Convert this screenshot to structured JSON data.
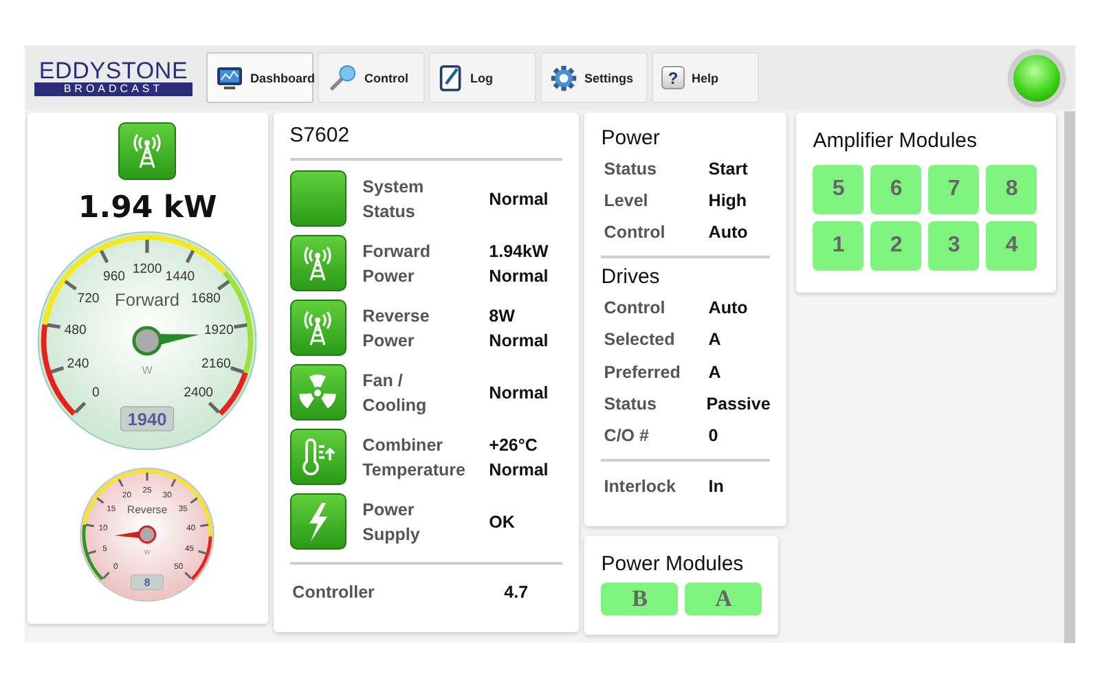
{
  "header": {
    "logo": {
      "name": "EDDYSTONE",
      "tagline": "BROADCAST"
    },
    "nav": [
      {
        "label": "Dashboard",
        "selected": true
      },
      {
        "label": "Control",
        "selected": false
      },
      {
        "label": "Log",
        "selected": false
      },
      {
        "label": "Settings",
        "selected": false
      },
      {
        "label": "Help",
        "glyph": "?",
        "selected": false
      }
    ],
    "status_light": {
      "on": true
    }
  },
  "meters": {
    "headline": "1.94 kW",
    "gauges": [
      {
        "title": "Forward",
        "unit": "W",
        "reading": "1940",
        "ticks": [
          "0",
          "240",
          "480",
          "720",
          "960",
          "1200",
          "1440",
          "1680",
          "1920",
          "2160",
          "2400"
        ]
      },
      {
        "title": "Reverse",
        "unit": "W",
        "reading": "8",
        "ticks": [
          "0",
          "5",
          "10",
          "15",
          "20",
          "25",
          "30",
          "35",
          "40",
          "45",
          "50"
        ]
      }
    ]
  },
  "system": {
    "title": "S7602",
    "rows": [
      {
        "label": "System Status",
        "values": [
          "Normal"
        ]
      },
      {
        "label": "Forward Power",
        "values": [
          "1.94kW",
          "Normal"
        ]
      },
      {
        "label": "Reverse Power",
        "values": [
          "8W",
          "Normal"
        ]
      },
      {
        "label": "Fan / Cooling",
        "values": [
          "Normal"
        ]
      },
      {
        "label": "Combiner Temperature",
        "values": [
          "+26°C",
          "Normal"
        ]
      },
      {
        "label": "Power Supply",
        "values": [
          "OK"
        ]
      }
    ],
    "footer": {
      "label": "Controller",
      "value": "4.7"
    }
  },
  "power": {
    "sections": [
      {
        "title": "Power",
        "rows": [
          {
            "label": "Status",
            "value": "Start"
          },
          {
            "label": "Level",
            "value": "High"
          },
          {
            "label": "Control",
            "value": "Auto"
          }
        ]
      },
      {
        "title": "Drives",
        "rows": [
          {
            "label": "Control",
            "value": "Auto"
          },
          {
            "label": "Selected",
            "value": "A"
          },
          {
            "label": "Preferred",
            "value": "A"
          },
          {
            "label": "Status",
            "value": "Passive"
          },
          {
            "label": "C/O #",
            "value": "0"
          }
        ]
      },
      {
        "rows": [
          {
            "label": "Interlock",
            "value": "In"
          }
        ]
      }
    ]
  },
  "power_modules": {
    "title": "Power Modules",
    "modules": [
      "B",
      "A"
    ]
  },
  "amplifier_modules": {
    "title": "Amplifier Modules",
    "modules": [
      "5",
      "6",
      "7",
      "8",
      "1",
      "2",
      "3",
      "4"
    ]
  }
}
